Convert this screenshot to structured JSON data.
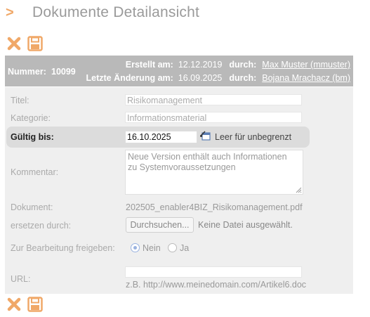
{
  "page": {
    "arrow": ">",
    "title": "Dokumente Detailansicht"
  },
  "toolbar": {
    "delete_icon": "close-x-icon",
    "save_icon": "floppy-disk-icon"
  },
  "header": {
    "number_label": "Nummer:",
    "number_value": "10099",
    "created_label": "Erstellt am:",
    "created_date": "12.12.2019",
    "created_by_label": "durch:",
    "created_by": "Max Muster (mmuster)",
    "modified_label": "Letzte Änderung am:",
    "modified_date": "16.09.2025",
    "modified_by_label": "durch:",
    "modified_by": "Bojana Mrachacz (bm)"
  },
  "form": {
    "title_label": "Titel:",
    "title_value": "Risikomanagement",
    "category_label": "Kategorie:",
    "category_value": "Informationsmaterial",
    "valid_label": "Gültig bis:",
    "valid_value": "16.10.2025",
    "valid_hint": "Leer für unbegrenzt",
    "comment_label": "Kommentar:",
    "comment_line1": "Neue Version enthält auch Informationen",
    "comment_line2": "zu Systemvoraussetzungen",
    "document_label": "Dokument:",
    "document_value": "202505_enabler4BIZ_Risikomanagement.pdf",
    "replace_label": "ersetzen durch:",
    "browse_button": "Durchsuchen...",
    "no_file_text": "Keine Datei ausgewählt.",
    "release_label": "Zur Bearbeitung freigeben:",
    "release_no": "Nein",
    "release_yes": "Ja",
    "release_selected": "Nein",
    "url_label": "URL:",
    "url_value": "",
    "url_hint": "z.B. http://www.meinedomain.com/Artikel6.doc"
  },
  "colors": {
    "accent": "#f0a868",
    "header_bg": "#b9b9b9",
    "form_bg": "#efefef",
    "radio": "#9ab3e0"
  }
}
